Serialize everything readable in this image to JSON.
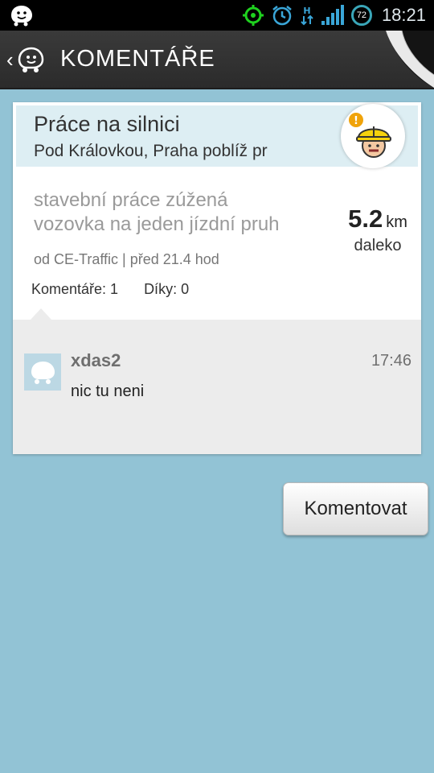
{
  "status_bar": {
    "time": "18:21",
    "battery_level": "72",
    "icons": [
      "waze-icon",
      "gps-icon",
      "alarm-icon",
      "hspa-data-icon",
      "signal-icon",
      "battery-icon"
    ]
  },
  "header": {
    "title": "KOMENTÁŘE",
    "back_icon": "chevron-left-icon",
    "app_icon": "waze-icon"
  },
  "alert": {
    "type": "Práce na silnici",
    "street": "Pod Královkou, Praha poblíž pr",
    "description_line1": "stavební práce zúžená",
    "description_line2": "vozovka na jeden jízdní pruh",
    "distance_value": "5.2",
    "distance_unit": "km",
    "distance_label": "daleko",
    "source": "od CE-Traffic | před 21.4 hod",
    "comments_count": "Komentáře: 1",
    "thanks_count": "Díky: 0",
    "icon": "construction-worker-icon"
  },
  "comments": [
    {
      "user": "xdas2",
      "time": "17:46",
      "text": "nic tu neni"
    }
  ],
  "actions": {
    "comment_button": "Komentovat"
  },
  "colors": {
    "background": "#92c3d5",
    "header_bg": "#2f2f2f",
    "card_header_bg": "#ddeef3",
    "comments_bg": "#ececec"
  }
}
